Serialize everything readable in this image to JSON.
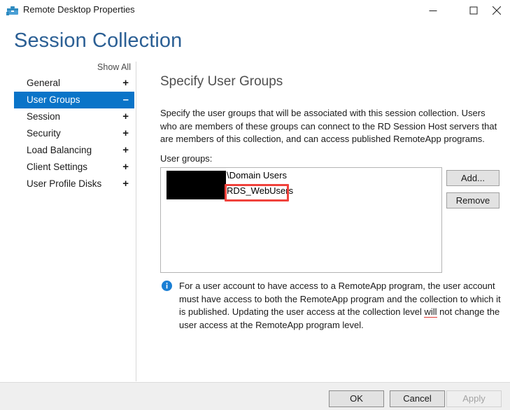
{
  "window": {
    "title": "Remote Desktop Properties",
    "icon": "remote-desktop-icon",
    "controls": {
      "minimize": "minimize-icon",
      "maximize": "maximize-icon",
      "close": "close-icon"
    }
  },
  "page_title": "Session Collection",
  "sidebar": {
    "show_all": "Show All",
    "items": [
      {
        "label": "General",
        "sign": "+",
        "selected": false
      },
      {
        "label": "User Groups",
        "sign": "–",
        "selected": true
      },
      {
        "label": "Session",
        "sign": "+",
        "selected": false
      },
      {
        "label": "Security",
        "sign": "+",
        "selected": false
      },
      {
        "label": "Load Balancing",
        "sign": "+",
        "selected": false
      },
      {
        "label": "Client Settings",
        "sign": "+",
        "selected": false
      },
      {
        "label": "User Profile Disks",
        "sign": "+",
        "selected": false
      }
    ]
  },
  "main": {
    "section_title": "Specify User Groups",
    "description": "Specify the user groups that will be associated with this session collection. Users who are members of these groups can connect to the RD Session Host servers that are members of this collection, and can access published RemoteApp programs.",
    "field_label": "User groups:",
    "list": {
      "rows": [
        {
          "prefix_redacted": true,
          "separator": "\\",
          "name": "Domain Users",
          "highlighted": false
        },
        {
          "prefix_redacted": true,
          "separator": "",
          "name": "RDS_WebUsers",
          "highlighted": true
        }
      ]
    },
    "side_buttons": {
      "add": "Add...",
      "remove": "Remove"
    },
    "info": {
      "icon": "info-icon",
      "text_part1": "For a user account to have access to a RemoteApp program, the user account must have access to both the RemoteApp program and the collection to which it is published. Updating the user access at the collection level ",
      "text_emphasis": "will",
      "text_part2": " not change the user access at the RemoteApp program level."
    }
  },
  "footer": {
    "ok": "OK",
    "cancel": "Cancel",
    "apply": "Apply",
    "apply_disabled": true
  },
  "colors": {
    "accent_blue": "#0a74c8",
    "title_blue": "#2b5f94",
    "highlight_red": "#f0423c",
    "footer_bg": "#efefef"
  }
}
